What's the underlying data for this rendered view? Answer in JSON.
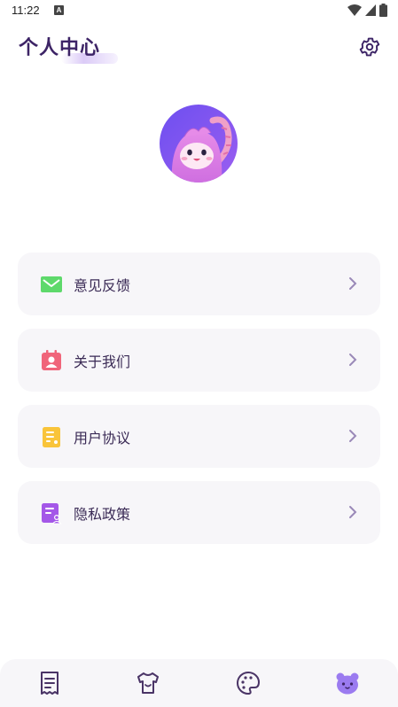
{
  "status": {
    "time": "11:22",
    "a_badge": "A"
  },
  "header": {
    "title": "个人中心",
    "settings_icon": "gear-icon"
  },
  "avatar": {
    "icon": "monster-avatar"
  },
  "menu": [
    {
      "label": "意见反馈",
      "icon": "mail-icon",
      "color": "#5ed96b"
    },
    {
      "label": "关于我们",
      "icon": "contact-card-icon",
      "color": "#f0657a"
    },
    {
      "label": "用户协议",
      "icon": "document-icon",
      "color": "#f9c43a"
    },
    {
      "label": "隐私政策",
      "icon": "privacy-document-icon",
      "color": "#a457e8"
    }
  ],
  "tabbar": [
    {
      "icon": "receipt-icon",
      "active": false
    },
    {
      "icon": "tshirt-icon",
      "active": false
    },
    {
      "icon": "palette-icon",
      "active": false
    },
    {
      "icon": "bear-icon",
      "active": true
    }
  ],
  "colors": {
    "accent": "#3d2466",
    "active": "#9b7bf0"
  }
}
